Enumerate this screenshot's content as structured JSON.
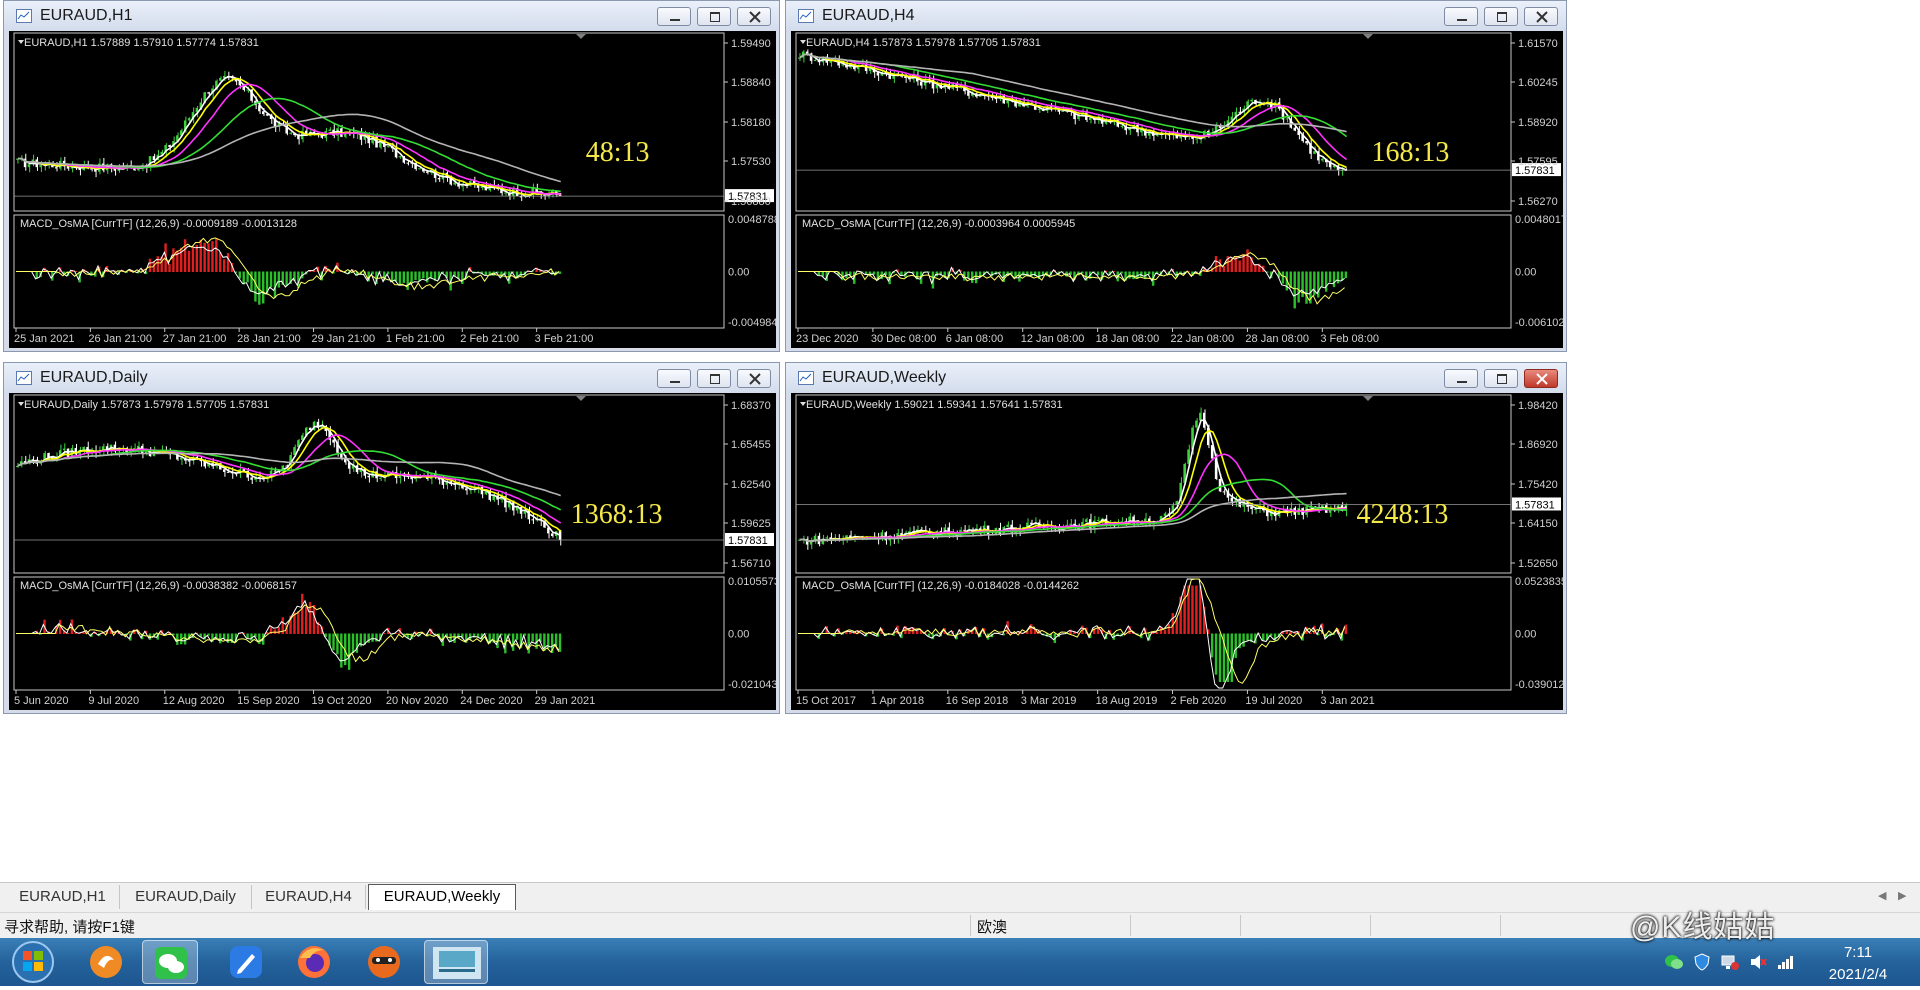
{
  "charts": [
    {
      "key": "h1",
      "window_title": "EURAUD,H1",
      "info": "EURAUD,H1  1.57889 1.57910 1.57774 1.57831",
      "price_axis": [
        "1.59490",
        "1.58840",
        "1.58180",
        "1.57530",
        "1.56880"
      ],
      "current_price": "1.57831",
      "countdown": "48:13",
      "macd_label": "MACD_OsMA [CurrTF] (12,26,9) -0.0009189 -0.0013128",
      "macd_axis": [
        "0.0048788",
        "0.00",
        "-0.0049844"
      ],
      "time_axis": [
        "25 Jan 2021",
        "26 Jan 21:00",
        "27 Jan 21:00",
        "28 Jan 21:00",
        "29 Jan 21:00",
        "1 Feb 21:00",
        "2 Feb 21:00",
        "3 Feb 21:00"
      ],
      "close_active": false
    },
    {
      "key": "h4",
      "window_title": "EURAUD,H4",
      "info": "EURAUD,H4  1.57873 1.57978 1.57705 1.57831",
      "price_axis": [
        "1.61570",
        "1.60245",
        "1.58920",
        "1.57595",
        "1.56270"
      ],
      "current_price": "1.57831",
      "countdown": "168:13",
      "macd_label": "MACD_OsMA [CurrTF] (12,26,9) -0.0003964 0.0005945",
      "macd_axis": [
        "0.0048017",
        "0.00",
        "-0.0061023"
      ],
      "time_axis": [
        "23 Dec 2020",
        "30 Dec 08:00",
        "6 Jan 08:00",
        "12 Jan 08:00",
        "18 Jan 08:00",
        "22 Jan 08:00",
        "28 Jan 08:00",
        "3 Feb 08:00"
      ],
      "close_active": false
    },
    {
      "key": "daily",
      "window_title": "EURAUD,Daily",
      "info": "EURAUD,Daily  1.57873 1.57978 1.57705 1.57831",
      "price_axis": [
        "1.68370",
        "1.65455",
        "1.62540",
        "1.59625",
        "1.56710"
      ],
      "current_price": "1.57831",
      "countdown": "1368:13",
      "macd_label": "MACD_OsMA [CurrTF] (12,26,9) -0.0038382 -0.0068157",
      "macd_axis": [
        "0.0105573",
        "0.00",
        "-0.0210437"
      ],
      "time_axis": [
        "5 Jun 2020",
        "9 Jul 2020",
        "12 Aug 2020",
        "15 Sep 2020",
        "19 Oct 2020",
        "20 Nov 2020",
        "24 Dec 2020",
        "29 Jan 2021"
      ],
      "close_active": false
    },
    {
      "key": "weekly",
      "window_title": "EURAUD,Weekly",
      "info": "EURAUD,Weekly  1.59021 1.59341 1.57641 1.57831",
      "price_axis": [
        "1.98420",
        "1.86920",
        "1.75420",
        "1.64150",
        "1.52650"
      ],
      "current_price": "1.57831",
      "countdown": "4248:13",
      "macd_label": "MACD_OsMA [CurrTF] (12,26,9) -0.0184028 -0.0144262",
      "macd_axis": [
        "0.0523835",
        "0.00",
        "-0.0390127"
      ],
      "time_axis": [
        "15 Oct 2017",
        "1 Apr 2018",
        "16 Sep 2018",
        "3 Mar 2019",
        "18 Aug 2019",
        "2 Feb 2020",
        "19 Jul 2020",
        "3 Jan 2021"
      ],
      "close_active": true
    }
  ],
  "tabs": [
    "EURAUD,H1",
    "EURAUD,Daily",
    "EURAUD,H4",
    "EURAUD,Weekly"
  ],
  "active_tab": "EURAUD,Weekly",
  "status": {
    "help_text": "寻求帮助, 请按F1键",
    "profile": "欧澳"
  },
  "taskbar": {
    "apps": [
      "start-orb-icon",
      "app-orange-icon",
      "wechat-icon",
      "pen-app-icon",
      "firefox-icon",
      "raccoon-app-icon",
      "mt4-terminal-icon"
    ],
    "time": "7:11",
    "date": "2021/2/4"
  },
  "watermark": "@K线姑姑",
  "colors": {
    "bull_candle": "#3fd43f",
    "bear_candle": "#ffffff",
    "macd_pos": "#e02020",
    "macd_neg": "#2bbf2b",
    "countdown": "#f5e94a",
    "ma_fast": "#ffffff",
    "ma_yellow": "#ffff00",
    "ma_magenta": "#ff33ff",
    "ma_green": "#33dd33",
    "ma_gray": "#b4b4b4"
  }
}
